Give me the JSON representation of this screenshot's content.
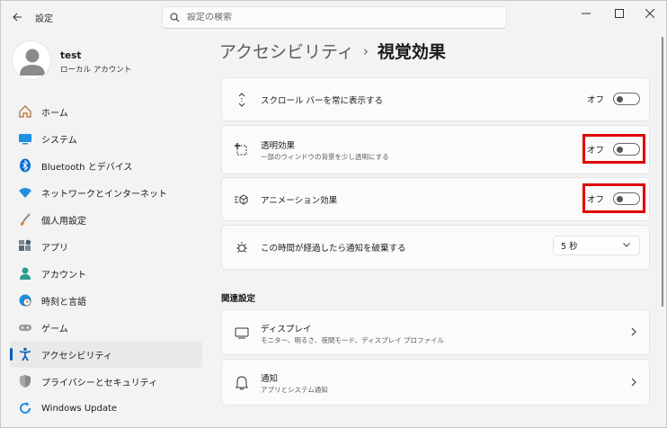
{
  "titlebar": {
    "app_title": "設定",
    "search_placeholder": "設定の検索"
  },
  "profile": {
    "name": "test",
    "account_type": "ローカル アカウント"
  },
  "sidebar": {
    "items": [
      {
        "label": "ホーム",
        "icon": "home-icon",
        "active": false
      },
      {
        "label": "システム",
        "icon": "system-icon",
        "active": false
      },
      {
        "label": "Bluetooth とデバイス",
        "icon": "bluetooth-icon",
        "active": false
      },
      {
        "label": "ネットワークとインターネット",
        "icon": "wifi-icon",
        "active": false
      },
      {
        "label": "個人用設定",
        "icon": "brush-icon",
        "active": false
      },
      {
        "label": "アプリ",
        "icon": "apps-icon",
        "active": false
      },
      {
        "label": "アカウント",
        "icon": "account-icon",
        "active": false
      },
      {
        "label": "時刻と言語",
        "icon": "globe-clock-icon",
        "active": false
      },
      {
        "label": "ゲーム",
        "icon": "gamepad-icon",
        "active": false
      },
      {
        "label": "アクセシビリティ",
        "icon": "accessibility-icon",
        "active": true
      },
      {
        "label": "プライバシーとセキュリティ",
        "icon": "shield-icon",
        "active": false
      },
      {
        "label": "Windows Update",
        "icon": "update-icon",
        "active": false
      }
    ]
  },
  "breadcrumb": {
    "parent": "アクセシビリティ",
    "separator": "›",
    "current": "視覚効果"
  },
  "settings": {
    "scrollbars": {
      "title": "スクロール バーを常に表示する",
      "state": "オフ"
    },
    "transparency": {
      "title": "透明効果",
      "desc": "一部のウィンドウの背景を少し透明にする",
      "state": "オフ"
    },
    "animation": {
      "title": "アニメーション効果",
      "state": "オフ"
    },
    "notification_dismiss": {
      "title": "この時間が経過したら通知を破棄する",
      "value": "5 秒"
    }
  },
  "related": {
    "heading": "関連設定",
    "display": {
      "title": "ディスプレイ",
      "desc": "モニター、明るさ、夜間モード、ディスプレイ プロファイル"
    },
    "notifications": {
      "title": "通知",
      "desc": "アプリとシステム通知"
    }
  },
  "colors": {
    "accent": "#005fb8",
    "highlight": "#e00000",
    "background": "#f3f3f3",
    "card": "#fbfbfb"
  }
}
